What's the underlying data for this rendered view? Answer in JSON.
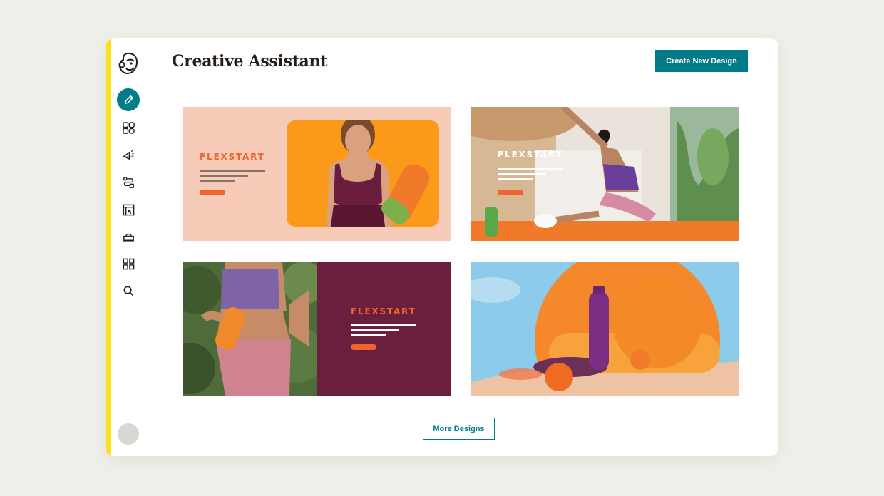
{
  "app": {
    "title": "Creative Assistant"
  },
  "header": {
    "create_label": "Create New Design"
  },
  "sidebar": {
    "items": [
      {
        "name": "create-icon",
        "active": true
      },
      {
        "name": "audience-icon"
      },
      {
        "name": "campaigns-icon"
      },
      {
        "name": "automations-icon"
      },
      {
        "name": "website-icon"
      },
      {
        "name": "content-studio-icon"
      },
      {
        "name": "integrations-icon"
      },
      {
        "name": "search-icon"
      }
    ]
  },
  "designs": [
    {
      "brand": "FLEXSTART",
      "variant": "peach-orange-model"
    },
    {
      "brand": "FLEXSTART",
      "variant": "yoga-stretch-photo"
    },
    {
      "brand": "FLEXSTART",
      "variant": "maroon-bottle-model"
    },
    {
      "brand": "",
      "variant": "product-still-life"
    }
  ],
  "footer": {
    "more_label": "More Designs"
  },
  "colors": {
    "accent": "#007c89",
    "yellow": "#ffe01b",
    "brand_orange": "#f0642d",
    "maroon": "#6a1f3f"
  }
}
